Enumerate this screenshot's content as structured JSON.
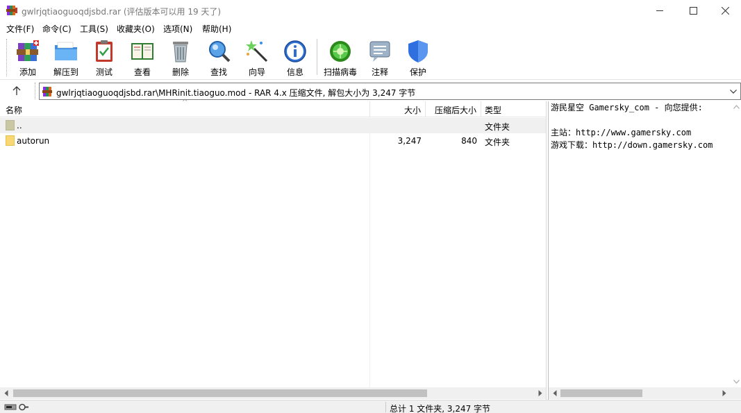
{
  "window": {
    "title": "gwlrjqtiaoguoqdjsbd.rar (评估版本可以用 19 天了)",
    "minimize_icon": "minimize-icon",
    "maximize_icon": "maximize-icon",
    "close_icon": "close-icon"
  },
  "menu": [
    {
      "label": "文件(F)"
    },
    {
      "label": "命令(C)"
    },
    {
      "label": "工具(S)"
    },
    {
      "label": "收藏夹(O)"
    },
    {
      "label": "选项(N)"
    },
    {
      "label": "帮助(H)"
    }
  ],
  "toolbar": [
    {
      "label": "添加",
      "icon": "add-archive-icon"
    },
    {
      "label": "解压到",
      "icon": "extract-folder-icon"
    },
    {
      "label": "测试",
      "icon": "test-clipboard-icon"
    },
    {
      "label": "查看",
      "icon": "view-book-icon"
    },
    {
      "label": "删除",
      "icon": "trash-icon"
    },
    {
      "label": "查找",
      "icon": "magnifier-icon"
    },
    {
      "label": "向导",
      "icon": "wizard-wand-icon"
    },
    {
      "label": "信息",
      "icon": "info-icon"
    },
    {
      "label": "扫描病毒",
      "icon": "virus-scan-icon"
    },
    {
      "label": "注释",
      "icon": "comment-icon"
    },
    {
      "label": "保护",
      "icon": "shield-icon"
    }
  ],
  "address": {
    "text": "gwlrjqtiaoguoqdjsbd.rar\\MHRinit.tiaoguo.mod - RAR 4.x 压缩文件, 解包大小为 3,247 字节"
  },
  "columns": {
    "name": "名称",
    "size": "大小",
    "packed": "压缩后大小",
    "type": "类型"
  },
  "rows": [
    {
      "name": "..",
      "size": "",
      "packed": "",
      "type": "文件夹"
    },
    {
      "name": "autorun",
      "size": "3,247",
      "packed": "840",
      "type": "文件夹"
    }
  ],
  "comment": {
    "text": "游民星空 Gamersky_com - 向您提供:\n\n主站：http://www.gamersky.com\n游戏下载：http://down.gamersky.com"
  },
  "status": {
    "text": "总计 1 文件夹, 3,247 字节"
  }
}
